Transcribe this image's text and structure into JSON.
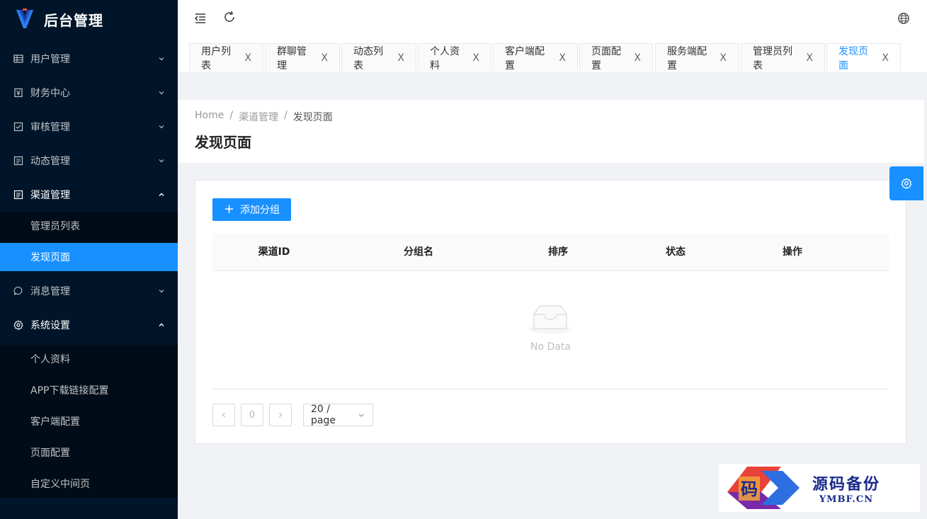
{
  "app": {
    "title": "后台管理"
  },
  "sidebar": {
    "menu": [
      {
        "label": "用户管理",
        "icon": "table-icon",
        "expanded": false
      },
      {
        "label": "财务中心",
        "icon": "wallet-icon",
        "expanded": false
      },
      {
        "label": "审核管理",
        "icon": "check-square-icon",
        "expanded": false
      },
      {
        "label": "动态管理",
        "icon": "profile-icon",
        "expanded": false
      },
      {
        "label": "渠道管理",
        "icon": "profile-icon",
        "expanded": true,
        "children": [
          "管理员列表",
          "发现页面"
        ],
        "active_child": "发现页面"
      },
      {
        "label": "消息管理",
        "icon": "message-icon",
        "expanded": false
      },
      {
        "label": "系统设置",
        "icon": "setting-icon",
        "expanded": true,
        "children": [
          "个人资料",
          "APP下载链接配置",
          "客户端配置",
          "页面配置",
          "自定义中间页"
        ]
      }
    ]
  },
  "header": {
    "icons": [
      "menu-fold-icon",
      "reload-icon",
      "globe-icon"
    ]
  },
  "tabs": [
    {
      "label": "用户列表",
      "active": false
    },
    {
      "label": "群聊管理",
      "active": false
    },
    {
      "label": "动态列表",
      "active": false
    },
    {
      "label": "个人资料",
      "active": false
    },
    {
      "label": "客户端配置",
      "active": false
    },
    {
      "label": "页面配置",
      "active": false
    },
    {
      "label": "服务端配置",
      "active": false
    },
    {
      "label": "管理员列表",
      "active": false
    },
    {
      "label": "发现页面",
      "active": true
    }
  ],
  "tab_close": "X",
  "breadcrumb": {
    "home": "Home",
    "sep": "/",
    "parent": "渠道管理",
    "current": "发现页面"
  },
  "page": {
    "title": "发现页面"
  },
  "toolbar": {
    "add_group_label": "添加分组"
  },
  "table": {
    "columns": [
      "渠道ID",
      "分组名",
      "排序",
      "状态",
      "操作"
    ],
    "empty_text": "No Data"
  },
  "pagination": {
    "current_page": "0",
    "page_size": "20 / page"
  },
  "watermark": {
    "cn": "源码备份",
    "en": "YMBF.CN",
    "logo_char": "码"
  },
  "colors": {
    "sidebar_bg": "#001529",
    "submenu_bg": "#000c17",
    "primary": "#1890ff"
  }
}
